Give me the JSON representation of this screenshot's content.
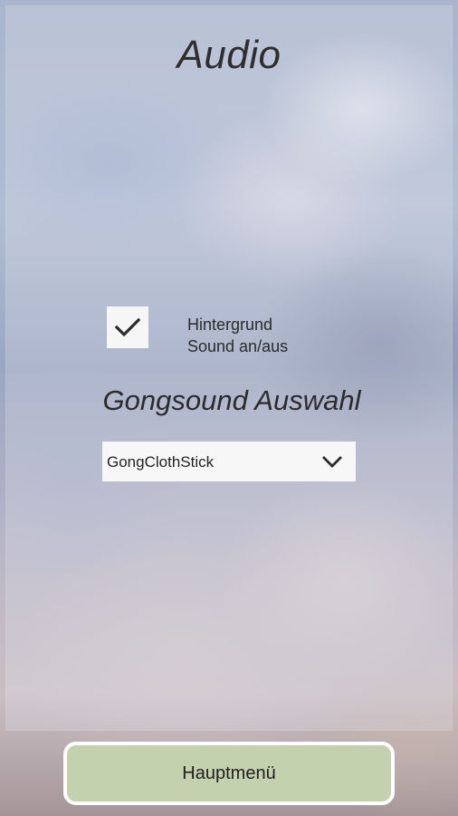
{
  "screen": {
    "title": "Audio"
  },
  "background_sound": {
    "checked": true,
    "label_line1": "Hintergrund",
    "label_line2": "Sound an/aus"
  },
  "gong": {
    "section_title": "Gongsound Auswahl",
    "selected": "GongClothStick"
  },
  "footer": {
    "main_menu_label": "Hauptmenü"
  },
  "icons": {
    "checkbox": "checkmark-icon",
    "dropdown": "chevron-down-icon"
  },
  "colors": {
    "button_fill": "#c3d1ae",
    "button_border": "#ffffff",
    "text": "#2b2b2b"
  }
}
